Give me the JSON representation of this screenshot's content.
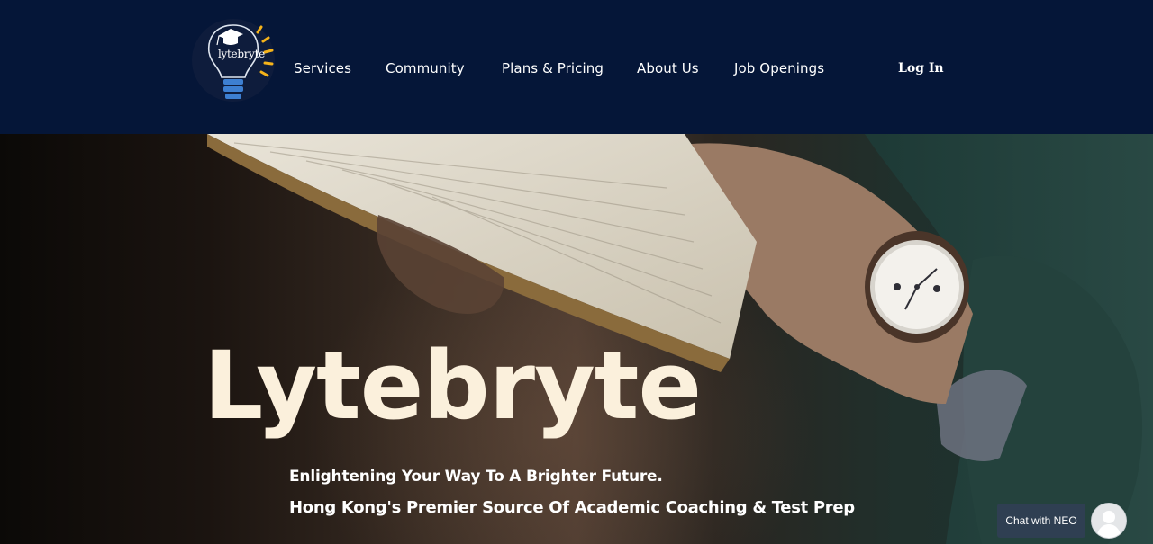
{
  "header": {
    "logo_text": "lytebryte",
    "nav": [
      {
        "label": "Services"
      },
      {
        "label": "Community"
      },
      {
        "label": "Plans & Pricing"
      },
      {
        "label": "About Us"
      },
      {
        "label": "Job Openings"
      }
    ],
    "login_label": "Log In"
  },
  "hero": {
    "title": "Lytebryte",
    "tagline_1": "Enlightening Your Way To A Brighter Future.",
    "tagline_2": "Hong Kong's Premier Source Of Academic Coaching & Test Prep"
  },
  "chat": {
    "label": "Chat with NEO"
  },
  "icons": {
    "logo": "lightbulb-graduation-cap-icon",
    "avatar": "user-avatar-icon"
  },
  "colors": {
    "header_bg": "#051638",
    "title": "#fbf0dc",
    "logo_rays": "#f5b31a",
    "logo_bulb": "#3d7fd1",
    "chat_bg": "#2f3f52"
  }
}
